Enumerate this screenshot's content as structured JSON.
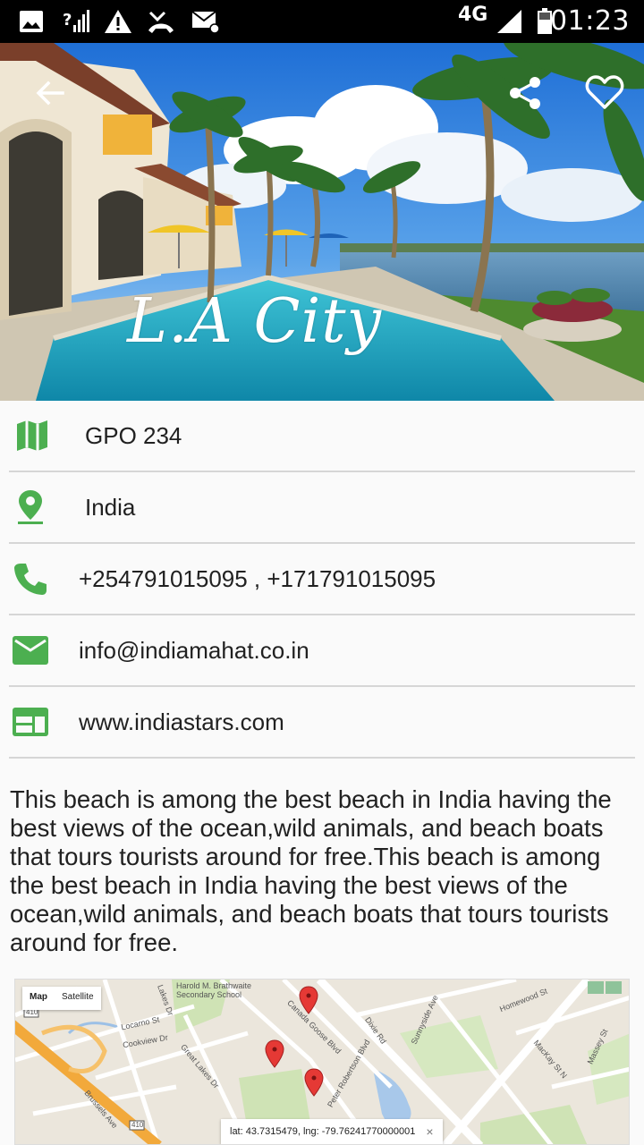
{
  "status_bar": {
    "network": "4G",
    "time": "01:23",
    "icons": [
      "image-icon",
      "no-signal-icon",
      "warning-icon",
      "missed-call-icon",
      "email-settings-icon",
      "signal-icon",
      "battery-icon"
    ]
  },
  "hero": {
    "title": "L.A City",
    "back_icon": "arrow-back-icon",
    "share_icon": "share-icon",
    "favorite_icon": "heart-outline-icon"
  },
  "info": {
    "address": "GPO 234",
    "country": "India",
    "phones": "+254791015095 , +171791015095",
    "email": "info@indiamahat.co.in",
    "website": "www.indiastars.com"
  },
  "colors": {
    "accent": "#4caf50",
    "divider": "#d6d6d6",
    "background": "#fafafa"
  },
  "description": "This beach is among the best beach in India having the best views of the ocean,wild animals, and beach boats that tours tourists around for free.This beach is among the best beach in India having the best views of the ocean,wild animals, and beach boats that tours tourists around for free.",
  "map": {
    "tab_map": "Map",
    "tab_satellite": "Satellite",
    "coords": "lat: 43.7315479, lng: -79.76241770000001",
    "close": "×",
    "labels": {
      "school": "Harold M. Brathwaite",
      "school2": "Secondary School",
      "locarno": "Locarno St",
      "cookview": "Cookview Dr",
      "canada_goose": "Canada Goose Blvd",
      "dixie": "Dixie Rd",
      "homewood": "Homewood St",
      "mackay": "MacKay St N",
      "great_lakes": "Great Lakes Dr",
      "brussels": "Brussels Ave",
      "peter": "Peter Robertson Blvd",
      "sunnyside": "Sunnyside Ave",
      "massey": "Massey St",
      "lakes": "Lakes Dr",
      "route": "410"
    }
  }
}
